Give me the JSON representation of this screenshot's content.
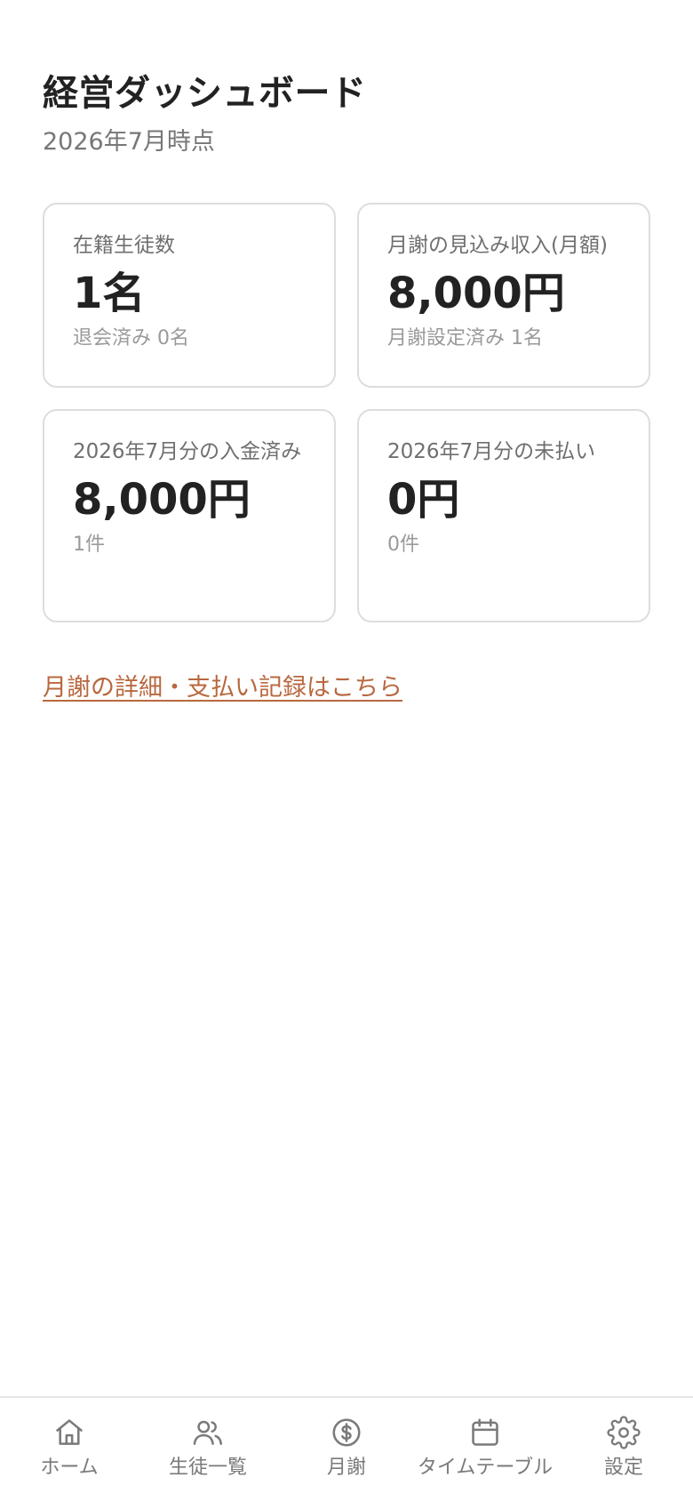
{
  "header": {
    "title": "経営ダッシュボード",
    "subtitle": "2026年7月時点"
  },
  "stats": [
    {
      "label": "在籍生徒数",
      "value": "1名",
      "sub": "退会済み 0名"
    },
    {
      "label": "月謝の見込み収入(月額)",
      "value": "8,000円",
      "sub": "月謝設定済み 1名"
    },
    {
      "label": "2026年7月分の入金済み",
      "value": "8,000円",
      "sub": "1件"
    },
    {
      "label": "2026年7月分の未払い",
      "value": "0円",
      "sub": "0件"
    }
  ],
  "detail_link": "月謝の詳細・支払い記録はこちら",
  "nav": {
    "items": [
      {
        "label": "ホーム",
        "icon": "home-icon"
      },
      {
        "label": "生徒一覧",
        "icon": "users-icon"
      },
      {
        "label": "月謝",
        "icon": "coin-icon"
      },
      {
        "label": "タイムテーブル",
        "icon": "calendar-icon"
      },
      {
        "label": "設定",
        "icon": "gear-icon"
      }
    ]
  },
  "colors": {
    "link": "#b8683f",
    "card_border": "#dddddd",
    "muted_text": "#777777"
  }
}
